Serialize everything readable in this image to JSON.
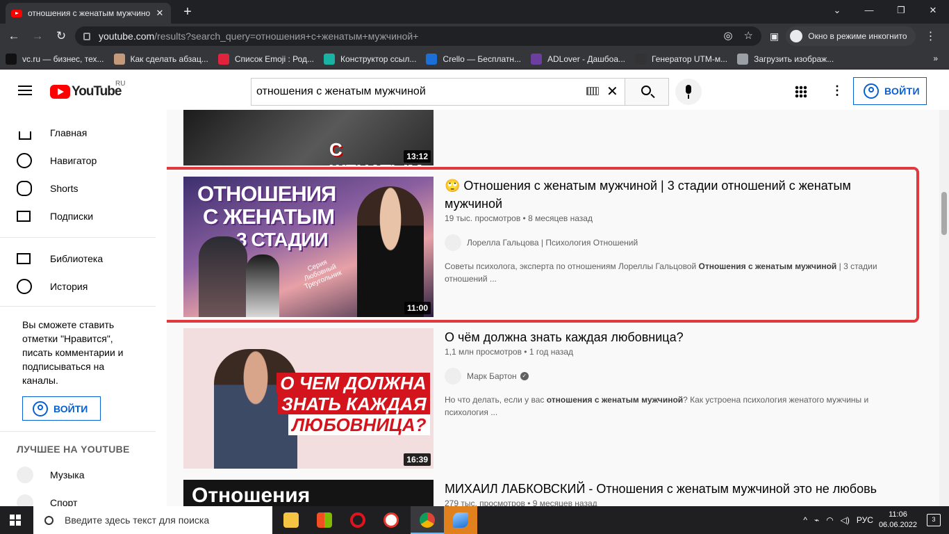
{
  "browser": {
    "tab_title": "отношения с женатым мужчино",
    "url_host": "youtube.com",
    "url_path": "/results?search_query=отношения+с+женатым+мужчиной+",
    "incognito_label": "Окно в режиме инкогнито",
    "bookmarks": [
      {
        "label": "vc.ru — бизнес, тех...",
        "color": "#111111"
      },
      {
        "label": "Как сделать абзац...",
        "color": "#c49a7a"
      },
      {
        "label": "Список Emoji : Род...",
        "color": "#e0243b"
      },
      {
        "label": "Конструктор ссыл...",
        "color": "#18b3a2"
      },
      {
        "label": "Crello — Бесплатн...",
        "color": "#1b6fd6"
      },
      {
        "label": "ADLover - Дашбоа...",
        "color": "#6b3fa0"
      },
      {
        "label": "Генератор UTM-м...",
        "color": "#333333"
      },
      {
        "label": "Загрузить изображ...",
        "color": "#9aa0a6"
      }
    ]
  },
  "youtube": {
    "logo_text": "YouTube",
    "country": "RU",
    "search_value": "отношения с женатым мужчиной",
    "signin_label": "ВОЙТИ",
    "sidebar": {
      "main": [
        "Главная",
        "Навигатор",
        "Shorts",
        "Подписки"
      ],
      "library": [
        "Библиотека",
        "История"
      ],
      "note": "Вы сможете ставить отметки \"Нравится\", писать комментарии и подписываться на каналы.",
      "signin_label": "ВОЙТИ",
      "best_header": "ЛУЧШЕЕ НА YOUTUBE",
      "best": [
        "Музыка",
        "Спорт"
      ]
    },
    "results": [
      {
        "duration": "13:12",
        "thumb_text": "С ЖЕНАТЫМ"
      },
      {
        "title": "🙄 Отношения с женатым мужчиной | 3 стадии отношений с женатым мужчиной",
        "views": "19 тыс. просмотров",
        "age": "8 месяцев назад",
        "channel": "Лорелла Гальцова | Психология Отношений",
        "desc_pre": "Советы психолога, эксперта по отношениям Лореллы Гальцовой ",
        "desc_bold": "Отношения с женатым мужчиной",
        "desc_post": " | 3 стадии отношений ...",
        "duration": "11:00",
        "thumb_l1": "ОТНОШЕНИЯ",
        "thumb_l2": "С ЖЕНАТЫМ",
        "thumb_l3": "3 СТАДИИ",
        "thumb_series": "Серия Любовный Треугольник"
      },
      {
        "title": "О чём должна знать каждая любовница?",
        "views": "1,1 млн просмотров",
        "age": "1 год назад",
        "channel": "Марк Бартон",
        "desc_pre": "Но что делать, если у вас ",
        "desc_bold": "отношения с женатым мужчиной",
        "desc_post": "? Как устроена психология женатого мужчины и психология ...",
        "duration": "16:39",
        "thumb_l1": "О ЧЕМ ДОЛЖНА",
        "thumb_l2": "ЗНАТЬ КАЖДАЯ",
        "thumb_l3": "ЛЮБОВНИЦА?"
      },
      {
        "title_bold": "МИХАИЛ ЛАБКОВСКИЙ - ",
        "title_rest": "Отношения с женатым мужчиной это не любовь",
        "views": "279 тыс. просмотров",
        "age": "9 месяцев назад",
        "thumb_text": "Отношения"
      }
    ]
  },
  "taskbar": {
    "search_placeholder": "Введите здесь текст для поиска",
    "lang": "РУС",
    "time": "11:06",
    "date": "06.06.2022",
    "notifications": "3"
  }
}
